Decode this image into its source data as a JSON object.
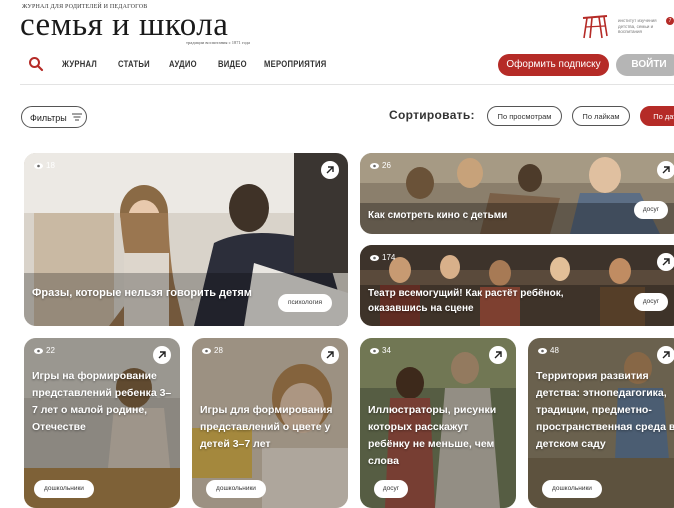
{
  "header": {
    "tagline": "ЖУРНАЛ ДЛЯ РОДИТЕЛЕЙ И ПЕДАГОГОВ",
    "logo": "семья и школа",
    "logo_sub": "традиции воспитания с 1871 года",
    "institute_text": "институт изучения детства, семьи и воспитания",
    "institute_badge": "7"
  },
  "nav": {
    "items": [
      "ЖУРНАЛ",
      "СТАТЬИ",
      "АУДИО",
      "ВИДЕО",
      "МЕРОПРИЯТИЯ"
    ],
    "subscribe": "Оформить подписку",
    "login": "ВОЙТИ"
  },
  "filters": {
    "label": "Фильтры"
  },
  "sort": {
    "label": "Сортировать:",
    "options": [
      "По просмотрам",
      "По лайкам",
      "По дат"
    ]
  },
  "cards": [
    {
      "views": "18",
      "title": "Фразы, которые нельзя говорить детям",
      "tag": "психология"
    },
    {
      "views": "26",
      "title": "Как смотреть кино с детьми",
      "tag": "досуг"
    },
    {
      "views": "174",
      "title": "Театр всемогущий! Как растёт ребёнок, оказавшись на сцене",
      "tag": "досуг"
    },
    {
      "views": "22",
      "title": "Игры на формирование представлений ребенка 3–7 лет о малой родине, Отечестве",
      "tag": "дошкольники"
    },
    {
      "views": "28",
      "title": "Игры для формирования представлений о цвете у детей 3–7 лет",
      "tag": "дошкольники"
    },
    {
      "views": "34",
      "title": "Иллюстраторы, рисунки которых расскажут ребёнку не меньше, чем слова",
      "tag": "досуг"
    },
    {
      "views": "48",
      "title": "Территория развития детства: этнопедагогика, традиции, предметно-пространственная среда в детском саду",
      "tag": "дошкольники"
    }
  ],
  "colors": {
    "accent": "#b52b27",
    "login_bg": "#b5b5b5"
  }
}
